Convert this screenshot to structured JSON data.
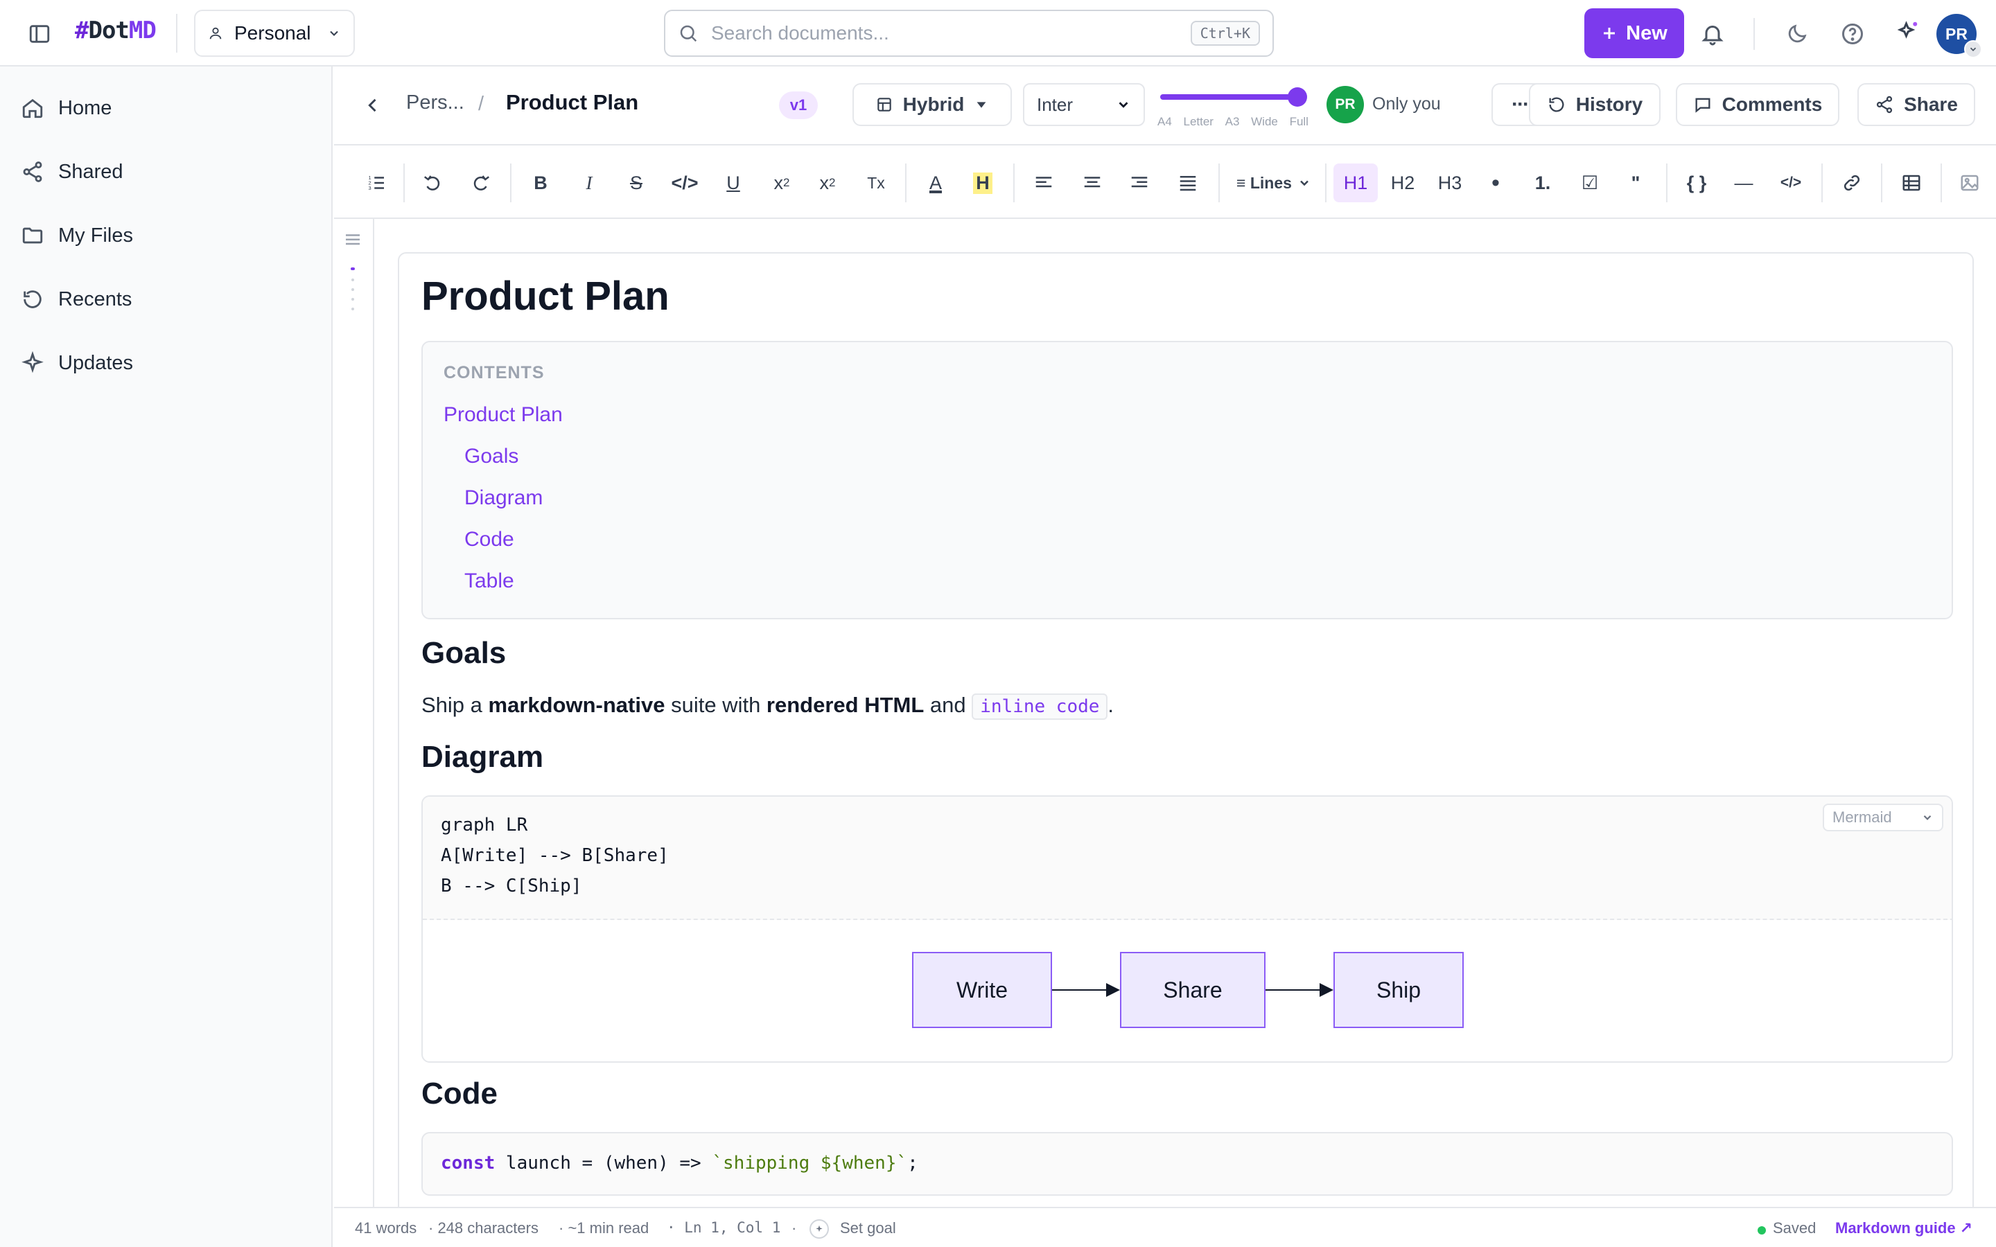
{
  "app": {
    "logo": {
      "hash": "#",
      "dot": "Dot",
      "md": "MD"
    },
    "workspace": "Personal",
    "search": {
      "placeholder": "Search documents...",
      "shortcut": "Ctrl+K"
    },
    "new_label": "New",
    "avatar_initials": "PR"
  },
  "sidebar": {
    "items": [
      {
        "label": "Home",
        "icon": "home-icon"
      },
      {
        "label": "Shared",
        "icon": "share-nodes-icon"
      },
      {
        "label": "My Files",
        "icon": "folder-icon"
      },
      {
        "label": "Recents",
        "icon": "history-icon"
      },
      {
        "label": "Updates",
        "icon": "sparkle-icon"
      }
    ]
  },
  "doc_header": {
    "breadcrumb_parent": "Pers...",
    "breadcrumb_sep": "/",
    "title": "Product Plan",
    "version": "v1",
    "view_mode": "Hybrid",
    "font": "Inter",
    "width_labels": [
      "A4",
      "Letter",
      "A3",
      "Wide",
      "Full"
    ],
    "width_selected": "Full",
    "presence_initials": "PR",
    "visibility": "Only you",
    "more_label": "···",
    "history_label": "History",
    "comments_label": "Comments",
    "share_label": "Share"
  },
  "toolbar": {
    "bold": "B",
    "italic": "I",
    "strike": "S",
    "code": "</>",
    "underline": "U",
    "superscript": "x",
    "sup_mark": "2",
    "subscript": "x",
    "sub_mark": "2",
    "clear": "Tx",
    "text_color": "A",
    "highlight": "H",
    "lines": "≡ Lines",
    "h1": "H1",
    "h2": "H2",
    "h3": "H3",
    "bullet": "•",
    "numbered": "1.",
    "task": "☑",
    "quote": "\"",
    "codeblock": "{ }",
    "hr": "—",
    "html": "</>"
  },
  "document": {
    "title": "Product Plan",
    "toc": {
      "label": "CONTENTS",
      "items": [
        "Product Plan",
        "Goals",
        "Diagram",
        "Code",
        "Table"
      ]
    },
    "goals": {
      "heading": "Goals",
      "text_1": "Ship a ",
      "bold_1": "markdown-native",
      "text_2": " suite with ",
      "bold_2": "rendered HTML",
      "text_3": " and ",
      "inline_code": "inline code",
      "text_4": "."
    },
    "diagram": {
      "heading": "Diagram",
      "language": "Mermaid",
      "source": [
        "graph LR",
        "A[Write] --> B[Share]",
        "B --> C[Ship]"
      ],
      "nodes": [
        "Write",
        "Share",
        "Ship"
      ]
    },
    "code": {
      "heading": "Code",
      "keyword": "const",
      "rest": " launch = (when) => ",
      "string": "`shipping ${when}`",
      "end": ";"
    }
  },
  "status": {
    "words": "41 words",
    "characters": "· 248 characters",
    "read_time": "· ~1 min read",
    "cursor": "· Ln 1, Col 1",
    "sep": "·",
    "goal": "Set goal",
    "saved": "Saved",
    "guide": "Markdown guide ↗"
  },
  "colors": {
    "accent": "#7c3aed",
    "saved": "#22c55e",
    "presence": "#16a34a",
    "avatar": "#1e4fa3"
  }
}
